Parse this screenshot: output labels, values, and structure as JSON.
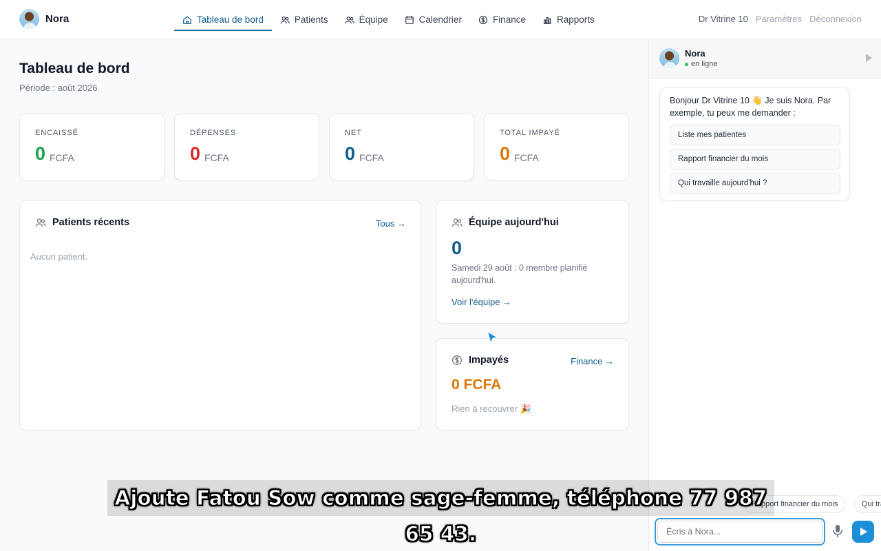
{
  "brand": {
    "name": "Nora"
  },
  "nav": {
    "items": [
      {
        "label": "Tableau de bord",
        "icon": "home-icon",
        "active": true
      },
      {
        "label": "Patients",
        "icon": "users-icon"
      },
      {
        "label": "Équipe",
        "icon": "team-icon"
      },
      {
        "label": "Calendrier",
        "icon": "calendar-icon"
      },
      {
        "label": "Finance",
        "icon": "dollar-icon"
      },
      {
        "label": "Rapports",
        "icon": "chart-icon"
      }
    ],
    "user": "Dr Vitrine 10",
    "settings": "Paramètres",
    "logout": "Déconnexion"
  },
  "page": {
    "title": "Tableau de bord",
    "period": "Période : août 2026"
  },
  "stats": [
    {
      "label": "ENCAISSÉ",
      "value": "0",
      "currency": "FCFA",
      "color": "#16a34a"
    },
    {
      "label": "DÉPENSES",
      "value": "0",
      "currency": "FCFA",
      "color": "#dc2626"
    },
    {
      "label": "NET",
      "value": "0",
      "currency": "FCFA",
      "color": "#0f5d8c"
    },
    {
      "label": "TOTAL IMPAYÉ",
      "value": "0",
      "currency": "FCFA",
      "color": "#d97706"
    }
  ],
  "recent_patients": {
    "title": "Patients récents",
    "link": "Tous →",
    "empty": "Aucun patient."
  },
  "team_today": {
    "title": "Équipe aujourd'hui",
    "count": "0",
    "description": "Samedi 29 août : 0 membre planifié aujourd'hui.",
    "link": "Voir l'équipe →"
  },
  "unpaid": {
    "title": "Impayés",
    "link": "Finance →",
    "amount": "0 FCFA",
    "note": "Rien à recouvrer 🎉"
  },
  "chat": {
    "name": "Nora",
    "status": "en ligne",
    "greeting": "Bonjour Dr Vitrine 10 👋 Je suis Nora. Par exemple, tu peux me demander :",
    "suggestions": [
      "Liste mes patientes",
      "Rapport financier du mois",
      "Qui travaille aujourd'hui ?"
    ],
    "chips": [
      "Rapport financier du mois",
      "Qui travaille aujourd'hui ?"
    ],
    "input_placeholder": "Écris à Nora..."
  },
  "subtitle": "Ajoute Fatou Sow comme sage-femme, téléphone 77 987 65 43."
}
